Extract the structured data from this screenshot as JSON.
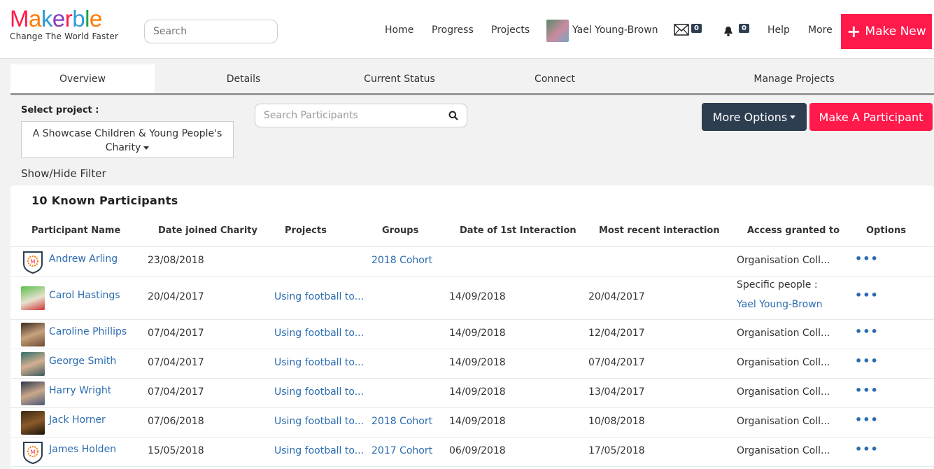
{
  "header": {
    "logo": "Makerble",
    "tagline": "Change The World Faster",
    "search_placeholder": "Search",
    "nav": [
      "Home",
      "Progress",
      "Projects"
    ],
    "user_name": "Yael Young-Brown",
    "messages_count": "0",
    "notifications_count": "0",
    "help": "Help",
    "more": "More",
    "make_new": "Make New"
  },
  "tabs": [
    "Overview",
    "Details",
    "Current Status",
    "Connect",
    "Manage Projects"
  ],
  "controls": {
    "select_label": "Select project :",
    "project_line1": "A Showcase Children & Young People's",
    "project_line2": "Charity",
    "search_placeholder": "Search Participants",
    "more_options": "More Options",
    "make_participant": "Make A Participant",
    "filter_toggle": "Show/Hide Filter"
  },
  "table": {
    "title": "10 Known Participants",
    "columns": [
      "Participant Name",
      "Date joined Charity",
      "Projects",
      "Groups",
      "Date of 1st Interaction",
      "Most recent interaction",
      "Access granted to",
      "Options"
    ],
    "rows": [
      {
        "name": "Andrew Arling",
        "joined": "23/08/2018",
        "project": "",
        "group": "2018 Cohort",
        "first": "",
        "recent": "",
        "access": "Organisation Coll...",
        "access2": "",
        "avatar": "shield"
      },
      {
        "name": "Carol Hastings",
        "joined": "20/04/2017",
        "project": "Using football to...",
        "group": "",
        "first": "14/09/2018",
        "recent": "20/04/2017",
        "access": "Specific people :",
        "access2": "Yael Young-Brown",
        "avatar": "photo-green"
      },
      {
        "name": "Caroline Phillips",
        "joined": "07/04/2017",
        "project": "Using football to...",
        "group": "",
        "first": "14/09/2018",
        "recent": "12/04/2017",
        "access": "Organisation Coll...",
        "access2": "",
        "avatar": "photo-brown"
      },
      {
        "name": "George Smith",
        "joined": "07/04/2017",
        "project": "Using football to...",
        "group": "",
        "first": "14/09/2018",
        "recent": "07/04/2017",
        "access": "Organisation Coll...",
        "access2": "",
        "avatar": "photo-teal"
      },
      {
        "name": "Harry Wright",
        "joined": "07/04/2017",
        "project": "Using football to...",
        "group": "",
        "first": "14/09/2018",
        "recent": "13/04/2017",
        "access": "Organisation Coll...",
        "access2": "",
        "avatar": "photo-slate"
      },
      {
        "name": "Jack Horner",
        "joined": "07/06/2018",
        "project": "Using football to...",
        "group": "2018 Cohort",
        "first": "14/09/2018",
        "recent": "10/08/2018",
        "access": "Organisation Coll...",
        "access2": "",
        "avatar": "photo-dark"
      },
      {
        "name": "James Holden",
        "joined": "15/05/2018",
        "project": "Using football to...",
        "group": "2017 Cohort",
        "first": "06/09/2018",
        "recent": "17/05/2018",
        "access": "Organisation Coll...",
        "access2": "",
        "avatar": "shield"
      }
    ],
    "options_glyph": "•••"
  },
  "colors": {
    "accent": "#ff1a4b",
    "navy": "#2d3e50",
    "link": "#2b6cb0"
  }
}
